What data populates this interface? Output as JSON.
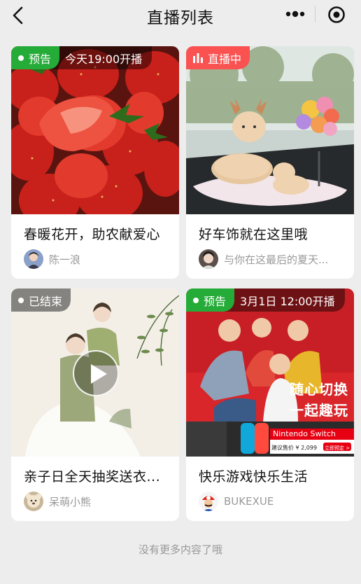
{
  "nav": {
    "title": "直播列表",
    "icons": [
      "back-arrow-icon",
      "more-dots-icon",
      "target-icon"
    ]
  },
  "cards": [
    {
      "status": "预告",
      "status_color": "#25ab38",
      "time": "今天19:00开播",
      "title": "春暖花开，助农献爱心",
      "author": "陈一浪"
    },
    {
      "status": "直播中",
      "status_color": "#fa5151",
      "title": "好车饰就在这里哦",
      "author": "与你在这最后的夏天..."
    },
    {
      "status": "已结束",
      "title": "亲子日全天抽奖送衣...",
      "author": "呆萌小熊"
    },
    {
      "status": "预告",
      "status_color": "#25ab38",
      "time": "3月1日 12:00开播",
      "title": "快乐游戏快乐生活",
      "author": "BUKEXUE",
      "cover_text": {
        "line1": "随心切换",
        "line2": "一起趣玩",
        "brand": "Nintendo Switch",
        "price": "建议售价 ¥ 2,099",
        "cta": "立即预定 >"
      }
    }
  ],
  "footer": "没有更多内容了哦"
}
